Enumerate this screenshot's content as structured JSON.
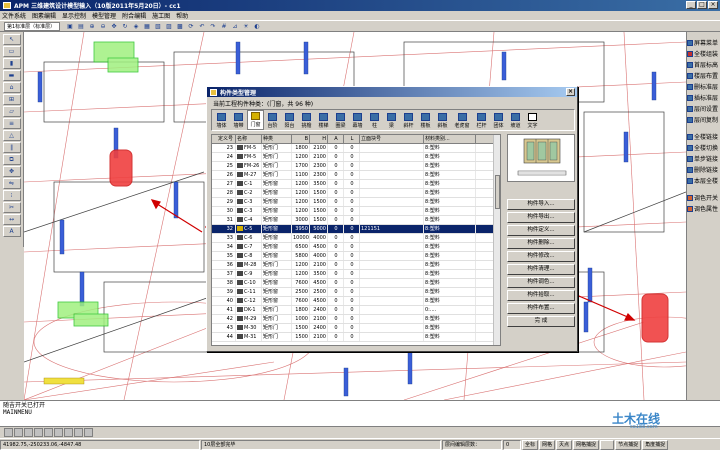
{
  "window": {
    "title": "APM 三维建筑设计模型输入（10版2011年5月20日）- cc1",
    "controls": [
      "_",
      "□",
      "×"
    ]
  },
  "menu": [
    "文件系统",
    "图素编辑",
    "显示控制",
    "模型管理",
    "附合编辑",
    "施工图",
    "帮助"
  ],
  "floor_select": "第1标准层（标准层）",
  "right_panel": {
    "items": [
      "屏幕菜单",
      "全楼组装",
      "首层标高",
      "楼层布置",
      "删标准层",
      "插标准层",
      "层间设置",
      "层间复制"
    ],
    "items2": [
      "全楼链接",
      "全楼切换",
      "单步链接",
      "删除链接",
      "本层全楼"
    ],
    "items3": [
      "调色开关",
      "调色属性"
    ]
  },
  "dialog": {
    "title": "构件类型管理",
    "subtitle": "当前工程构件种类：(门窗，共 96 种)",
    "tabs": [
      "墙体",
      "墙带",
      "门窗",
      "台阶",
      "阳台",
      "挑檐",
      "楼梯",
      "圈梁",
      "幕墙",
      "柱",
      "梁",
      "斜杆",
      "楼板",
      "斜板",
      "老虎窗",
      "栏杆",
      "团体",
      "坡道",
      "文字"
    ],
    "active_tab": "门窗",
    "columns": [
      "定义号",
      "名称",
      "种类",
      "B",
      "H",
      "A",
      "L",
      "立面块号",
      "材料类别..."
    ],
    "rows": [
      {
        "no": "23",
        "name": "FM-5",
        "kind": "矩形门",
        "b": "1800",
        "h": "2100",
        "a": "0",
        "l": "0",
        "block": "",
        "mat": "8:塑料"
      },
      {
        "no": "24",
        "name": "FM-5",
        "kind": "矩形门",
        "b": "1200",
        "h": "2100",
        "a": "0",
        "l": "0",
        "block": "",
        "mat": "8:塑料"
      },
      {
        "no": "25",
        "name": "FM-26",
        "kind": "矩形门",
        "b": "1700",
        "h": "2300",
        "a": "0",
        "l": "0",
        "block": "",
        "mat": "8:塑料"
      },
      {
        "no": "26",
        "name": "M-27",
        "kind": "矩形门",
        "b": "1100",
        "h": "2300",
        "a": "0",
        "l": "0",
        "block": "",
        "mat": "8:塑料"
      },
      {
        "no": "27",
        "name": "C-1",
        "kind": "矩形窗",
        "b": "1200",
        "h": "3500",
        "a": "0",
        "l": "0",
        "block": "",
        "mat": "8:塑料"
      },
      {
        "no": "28",
        "name": "C-2",
        "kind": "矩形窗",
        "b": "1200",
        "h": "1500",
        "a": "0",
        "l": "0",
        "block": "",
        "mat": "8:塑料"
      },
      {
        "no": "29",
        "name": "C-3",
        "kind": "矩形窗",
        "b": "1200",
        "h": "1500",
        "a": "0",
        "l": "0",
        "block": "",
        "mat": "8:塑料"
      },
      {
        "no": "30",
        "name": "C-3",
        "kind": "矩形窗",
        "b": "1200",
        "h": "1500",
        "a": "0",
        "l": "0",
        "block": "",
        "mat": "8:塑料"
      },
      {
        "no": "31",
        "name": "C-4",
        "kind": "矩形窗",
        "b": "3000",
        "h": "1500",
        "a": "0",
        "l": "0",
        "block": "",
        "mat": "8:塑料"
      },
      {
        "no": "32",
        "name": "C-5",
        "kind": "矩形窗",
        "b": "3950",
        "h": "5000",
        "a": "0",
        "l": "0",
        "block": "121151",
        "mat": "8:塑料"
      },
      {
        "no": "33",
        "name": "C-6",
        "kind": "矩形窗",
        "b": "10000",
        "h": "4000",
        "a": "0",
        "l": "0",
        "block": "",
        "mat": "8:塑料"
      },
      {
        "no": "34",
        "name": "C-7",
        "kind": "矩形窗",
        "b": "6500",
        "h": "4500",
        "a": "0",
        "l": "0",
        "block": "",
        "mat": "8:塑料"
      },
      {
        "no": "35",
        "name": "C-8",
        "kind": "矩形窗",
        "b": "5800",
        "h": "4000",
        "a": "0",
        "l": "0",
        "block": "",
        "mat": "8:塑料"
      },
      {
        "no": "36",
        "name": "M-28",
        "kind": "矩形门",
        "b": "1200",
        "h": "2100",
        "a": "0",
        "l": "0",
        "block": "",
        "mat": "8:塑料"
      },
      {
        "no": "37",
        "name": "C-9",
        "kind": "矩形窗",
        "b": "1200",
        "h": "3500",
        "a": "0",
        "l": "0",
        "block": "",
        "mat": "8:塑料"
      },
      {
        "no": "38",
        "name": "C-10",
        "kind": "矩形窗",
        "b": "7600",
        "h": "4500",
        "a": "0",
        "l": "0",
        "block": "",
        "mat": "8:塑料"
      },
      {
        "no": "39",
        "name": "C-11",
        "kind": "矩形窗",
        "b": "2500",
        "h": "2500",
        "a": "0",
        "l": "0",
        "block": "",
        "mat": "8:塑料"
      },
      {
        "no": "40",
        "name": "C-12",
        "kind": "矩形窗",
        "b": "7600",
        "h": "4500",
        "a": "0",
        "l": "0",
        "block": "",
        "mat": "8:塑料"
      },
      {
        "no": "41",
        "name": "DK-1",
        "kind": "矩形门",
        "b": "1800",
        "h": "2400",
        "a": "0",
        "l": "0",
        "block": "",
        "mat": "0:...."
      },
      {
        "no": "42",
        "name": "M-29",
        "kind": "矩形门",
        "b": "1000",
        "h": "2100",
        "a": "0",
        "l": "0",
        "block": "",
        "mat": "8:塑料"
      },
      {
        "no": "43",
        "name": "M-30",
        "kind": "矩形门",
        "b": "1500",
        "h": "2400",
        "a": "0",
        "l": "0",
        "block": "",
        "mat": "8:塑料"
      },
      {
        "no": "44",
        "name": "M-31",
        "kind": "矩形门",
        "b": "1500",
        "h": "2100",
        "a": "0",
        "l": "0",
        "block": "",
        "mat": "8:塑料"
      }
    ],
    "selected_row": "32",
    "buttons": [
      "构件导入...",
      "构件导出...",
      "构件定义...",
      "构件删除...",
      "构件修改...",
      "构件清理...",
      "构件调色...",
      "构件拾取...",
      "构件布置...",
      "完 成"
    ]
  },
  "command": {
    "line1": "随吉开关已打开",
    "line2": "MAINMENU"
  },
  "status": {
    "coords": "41982.75,-250233.06,-4847.48",
    "message": "10层全部完毕",
    "edit_state": "层间编辑层数：",
    "edit_value": "0",
    "buttons": [
      "全标",
      "网格",
      "灭点",
      "网格捕捉",
      "",
      "节点捕捉",
      "角度捕捉"
    ]
  },
  "watermark": {
    "text": "土木在线",
    "sub": "co188.com"
  }
}
